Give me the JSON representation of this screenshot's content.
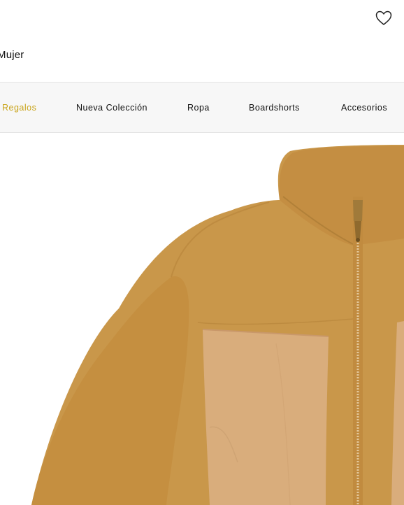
{
  "header": {
    "wishlist_icon": "heart-outline-icon",
    "section_label": "Mujer"
  },
  "nav": {
    "items": [
      {
        "label": "Regalos",
        "active": true
      },
      {
        "label": "Nueva Colección",
        "active": false
      },
      {
        "label": "Ropa",
        "active": false
      },
      {
        "label": "Boardshorts",
        "active": false
      },
      {
        "label": "Accesorios",
        "active": false
      }
    ],
    "active_color": "#c9a41a"
  },
  "product": {
    "image_subject": "tan fleece zip jacket with light canvas chest panels",
    "colors": {
      "fleece": "#c9974a",
      "panel": "#d9ad7c",
      "zipper": "#a07a3a"
    }
  }
}
